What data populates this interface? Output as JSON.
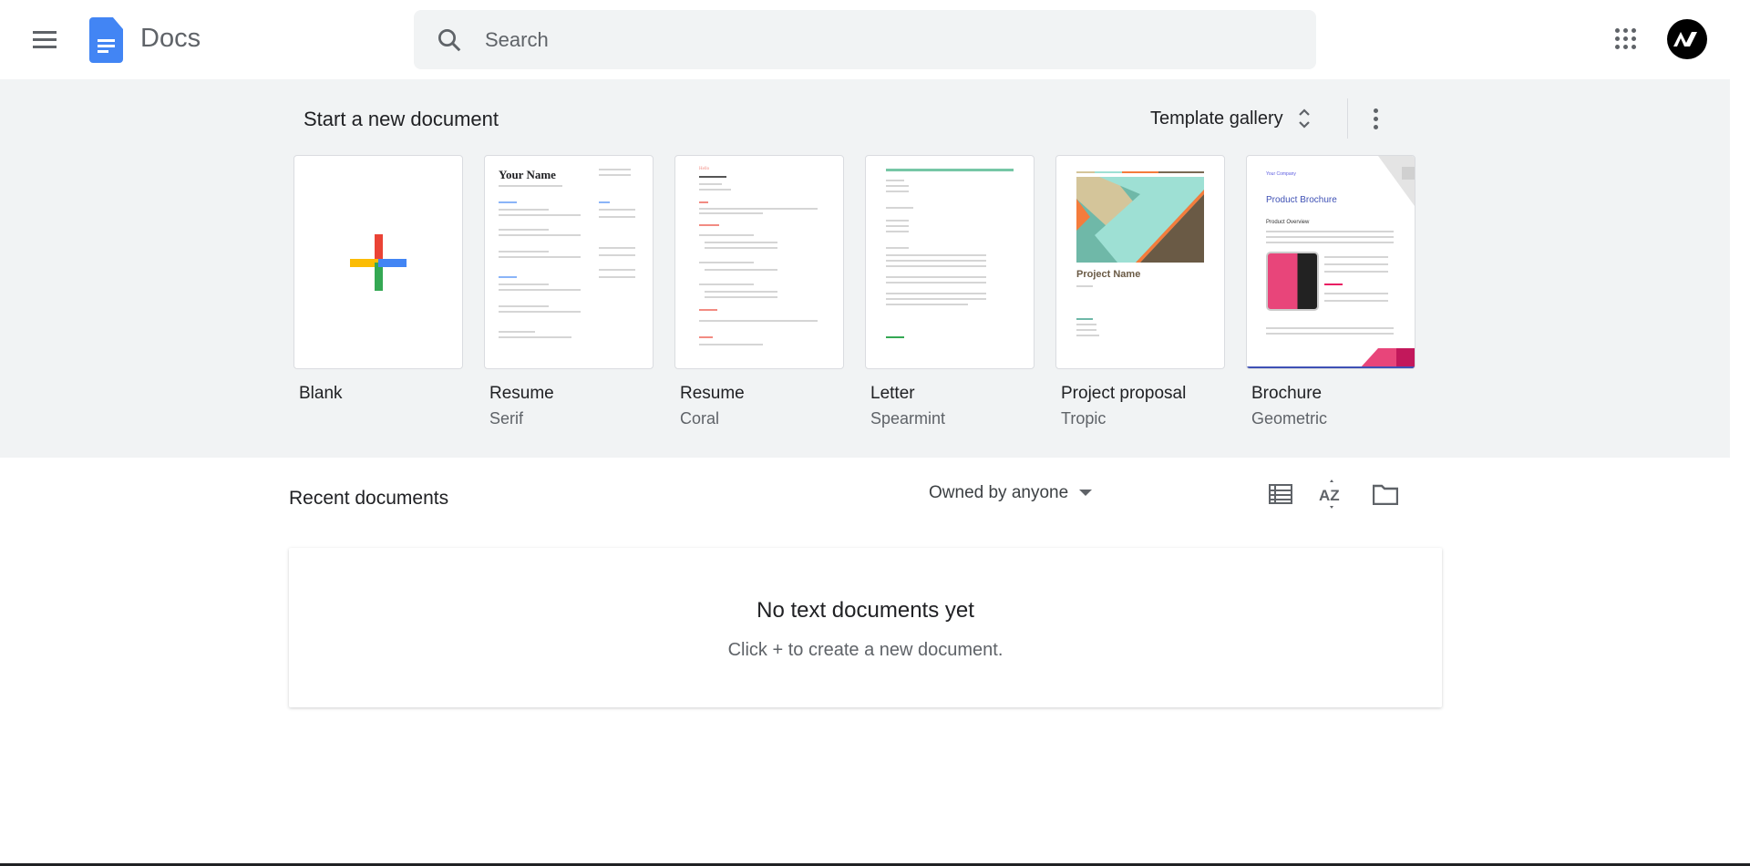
{
  "header": {
    "app_name": "Docs",
    "search_placeholder": "Search",
    "avatar_initials": "AV"
  },
  "start": {
    "title": "Start a new document",
    "template_gallery": "Template gallery"
  },
  "templates": [
    {
      "name": "Blank",
      "sub": ""
    },
    {
      "name": "Resume",
      "sub": "Serif",
      "preview_title": "Your Name"
    },
    {
      "name": "Resume",
      "sub": "Coral",
      "preview_title": "Hello"
    },
    {
      "name": "Letter",
      "sub": "Spearmint"
    },
    {
      "name": "Project proposal",
      "sub": "Tropic",
      "preview_title": "Project Name"
    },
    {
      "name": "Brochure",
      "sub": "Geometric",
      "preview_company": "Your Company",
      "preview_title": "Product Brochure",
      "preview_heading": "Product Overview"
    }
  ],
  "recent": {
    "title": "Recent documents",
    "owner_filter": "Owned by anyone",
    "empty_title": "No text documents yet",
    "empty_hint": "Click + to create a new document."
  },
  "colors": {
    "accent": "#4285f4",
    "band": "#f1f3f4"
  }
}
